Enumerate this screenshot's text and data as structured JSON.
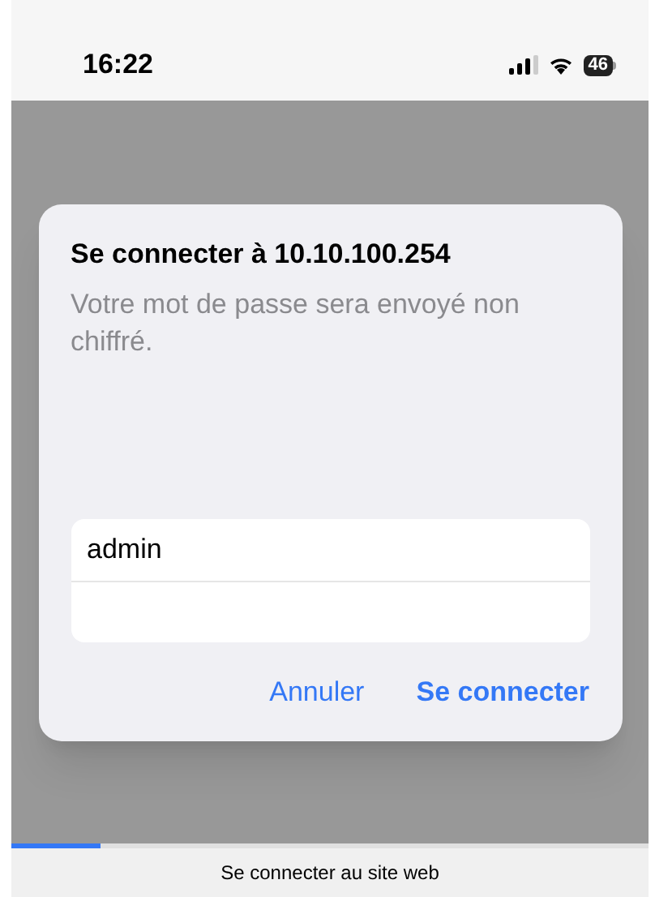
{
  "status_bar": {
    "time": "16:22",
    "battery": "46"
  },
  "dialog": {
    "title": "Se connecter à 10.10.100.254",
    "message": "Votre mot de passe sera envoyé non chiffré.",
    "fields": [
      {
        "kind": "username",
        "value": "admin"
      },
      {
        "kind": "password"
      }
    ],
    "buttons": [
      {
        "label": "Annuler",
        "primary": false
      },
      {
        "label": "Se connecter",
        "primary": true
      }
    ]
  },
  "loading": {
    "level": 0.14,
    "label": "Se connecter au site web"
  }
}
